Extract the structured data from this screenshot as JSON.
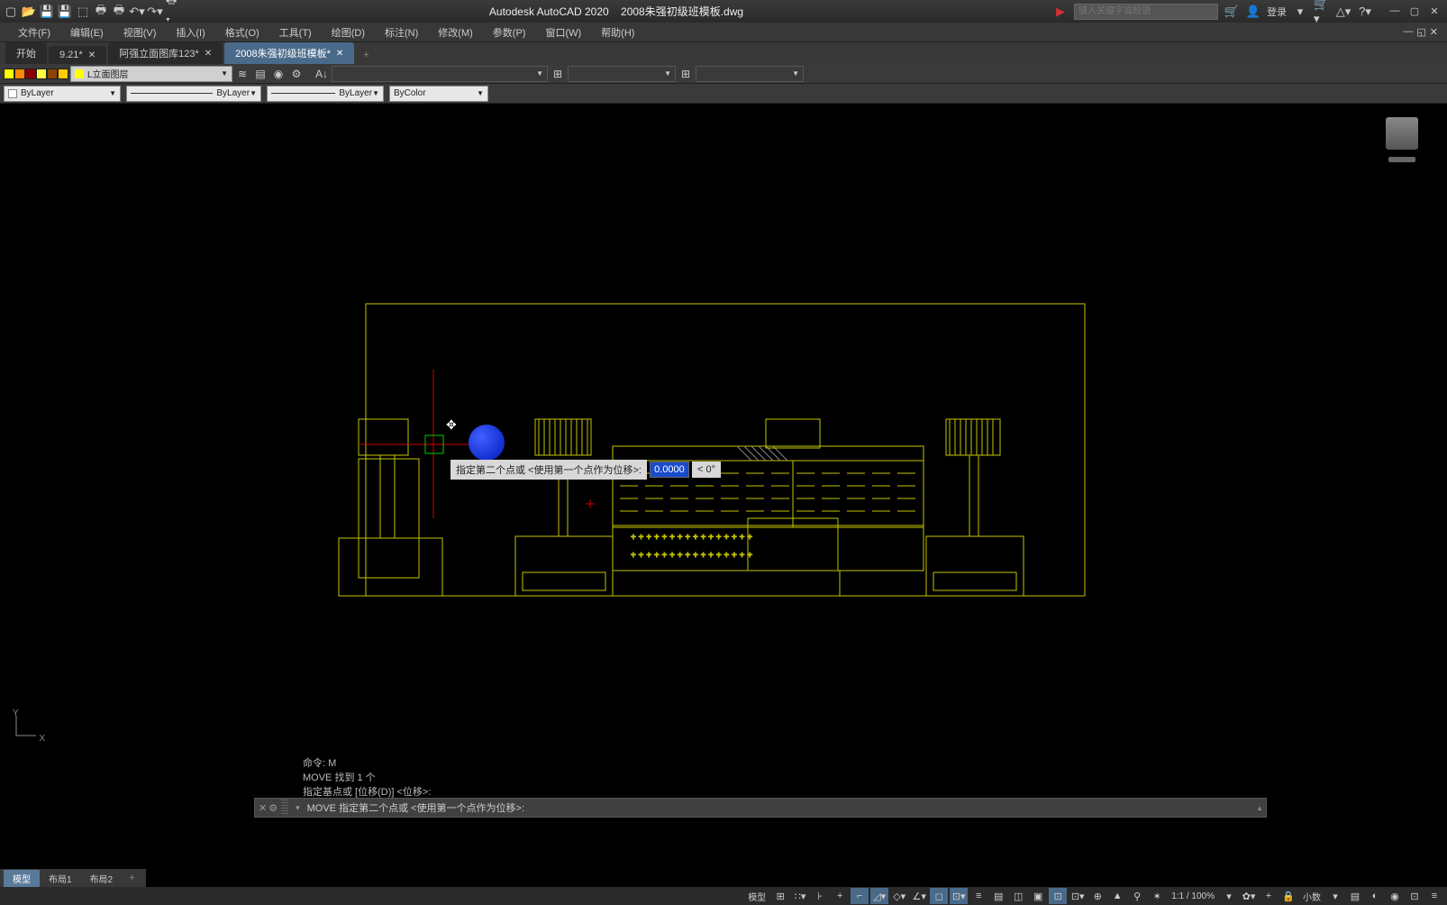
{
  "titlebar": {
    "app": "Autodesk AutoCAD 2020",
    "file": "2008朱强初级班模板.dwg",
    "search_placeholder": "键入关键字或短语",
    "login": "登录"
  },
  "menubar": {
    "items": [
      "文件(F)",
      "编辑(E)",
      "视图(V)",
      "插入(I)",
      "格式(O)",
      "工具(T)",
      "绘图(D)",
      "标注(N)",
      "修改(M)",
      "参数(P)",
      "窗口(W)",
      "帮助(H)"
    ]
  },
  "filetabs": {
    "items": [
      {
        "label": "开始",
        "closeable": false
      },
      {
        "label": "9.21*",
        "closeable": true
      },
      {
        "label": "阿强立面图库123*",
        "closeable": true
      },
      {
        "label": "2008朱强初级班模板*",
        "closeable": true,
        "active": true
      }
    ]
  },
  "layer_row": {
    "layer_combo": "L立面图层",
    "colors": [
      "#ffff00",
      "#ff8800",
      "#880000",
      "#ffff44",
      "#884400",
      "#ffcc00"
    ]
  },
  "prop_row": {
    "color": "ByLayer",
    "linetype": "ByLayer",
    "lineweight": "ByLayer",
    "plotstyle": "ByColor"
  },
  "dyn_input": {
    "prompt": "指定第二个点或 <使用第一个点作为位移>:",
    "distance": "0.0000",
    "angle": "< 0°"
  },
  "cmd_history": {
    "l1": "命令: M",
    "l2": "MOVE 找到 1 个",
    "l3": "指定基点或 [位移(D)] <位移>:"
  },
  "cmd_line": {
    "prompt": "MOVE 指定第二个点或 <使用第一个点作为位移>:"
  },
  "layouttabs": {
    "items": [
      {
        "label": "模型",
        "active": true
      },
      {
        "label": "布局1"
      },
      {
        "label": "布局2"
      }
    ]
  },
  "statusbar": {
    "model": "模型",
    "scale": "1:1 / 100%",
    "precision": "小数"
  },
  "ucs": {
    "y": "Y",
    "x": "X"
  }
}
